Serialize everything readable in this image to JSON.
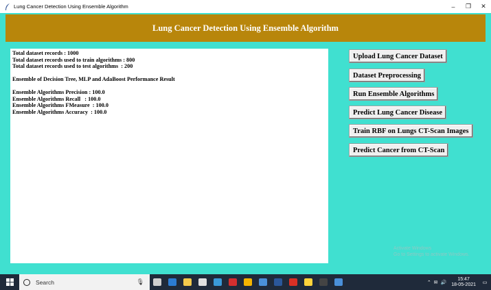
{
  "window": {
    "title": "Lung Cancer Detection Using Ensemble Algorithm",
    "controls": {
      "minimize": "–",
      "maximize": "❐",
      "close": "✕"
    }
  },
  "header": {
    "title": "Lung Cancer Detection Using Ensemble Algorithm"
  },
  "output_text": "Total dataset records : 1000\nTotal dataset records used to train algorithms : 800\nTotal dataset records used to test algorithms  : 200\n\nEnsemble of Decision Tree, MLP and AdaBoost Performance Result\n\nEnsemble Algorithms Precision : 100.0\nEnsemble Algorithms Recall   : 100.0\nEnsemble Algorithms FMeasure  : 100.0\nEnsemble Algorithms Accuracy  : 100.0",
  "buttons": {
    "upload": "Upload Lung Cancer Dataset",
    "preprocess": "Dataset Preprocessing",
    "run_ensemble": "Run Ensemble Algorithms",
    "predict_disease": "Predict Lung Cancer Disease",
    "train_rbf": "Train RBF on Lungs CT-Scan Images",
    "predict_ct": "Predict Cancer from CT-Scan"
  },
  "watermark": {
    "line1": "Activate Windows",
    "line2": "Go to Settings to activate Windows."
  },
  "taskbar": {
    "search_label": "Search",
    "clock_time": "15:47",
    "clock_date": "18-05-2021",
    "icons": [
      "task-view-icon",
      "edge-icon",
      "file-explorer-icon",
      "store-icon",
      "photos-icon",
      "opera-icon",
      "chrome-icon",
      "files-icon",
      "word-icon",
      "acrobat-icon",
      "python-icon",
      "terminal-icon",
      "app-icon"
    ],
    "icon_colors": [
      "#cfcfcf",
      "#2b7cd3",
      "#f2c94c",
      "#e0e0e0",
      "#3a9ad9",
      "#d32f2f",
      "#f4b400",
      "#4a90d9",
      "#2b579a",
      "#d93025",
      "#ffd43b",
      "#444444",
      "#4a90d9"
    ]
  },
  "colors": {
    "background": "#40e0d0",
    "header": "#b8860b",
    "taskbar": "#1f2a3a"
  }
}
